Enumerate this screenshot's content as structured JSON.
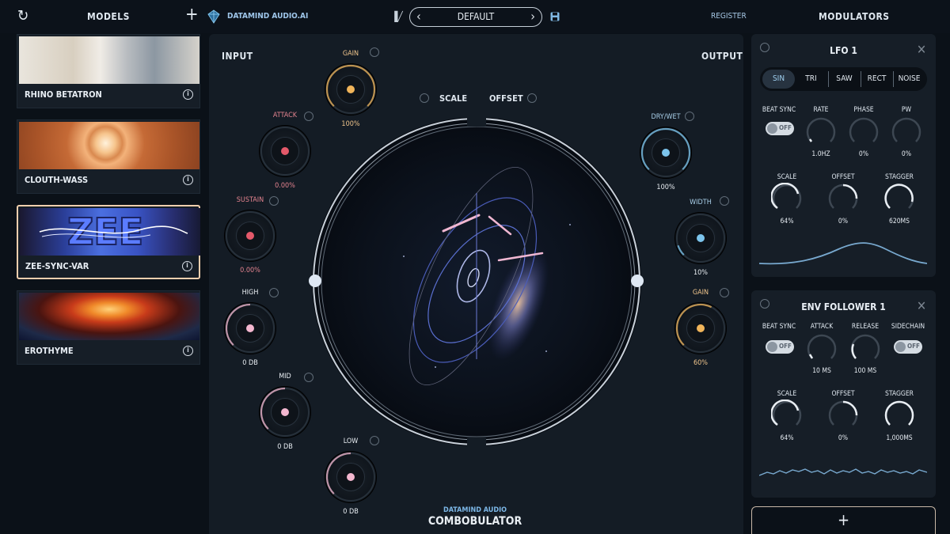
{
  "header": {
    "models_title": "MODELS",
    "brand_link": "DATAMIND AUDIO.AI",
    "preset_name": "DEFAULT",
    "register_label": "REGISTER",
    "modulators_title": "MODULATORS"
  },
  "models": [
    {
      "name": "RHINO BETATRON",
      "selected": false
    },
    {
      "name": "CLOUTH-WASS",
      "selected": false
    },
    {
      "name": "ZEE-SYNC-VAR",
      "selected": true
    },
    {
      "name": "EROTHYME",
      "selected": false
    }
  ],
  "main": {
    "input_label": "INPUT",
    "output_label": "OUTPUT",
    "scale_label": "SCALE",
    "offset_label": "OFFSET",
    "footer_brand": "DATAMIND AUDIO",
    "footer_product": "COMBOBULATOR",
    "knobs": {
      "gain_in": {
        "title": "GAIN",
        "value": "100%",
        "color": "#f0b45a",
        "level": 1.0
      },
      "attack": {
        "title": "ATTACK",
        "value": "0.00%",
        "color": "#e4596a",
        "level": 0.0
      },
      "sustain": {
        "title": "SUSTAIN",
        "value": "0.00%",
        "color": "#e4596a",
        "level": 0.0
      },
      "high": {
        "title": "HIGH",
        "value": "0 DB",
        "color": "#f3b7cf",
        "level": 0.5
      },
      "mid": {
        "title": "MID",
        "value": "0 DB",
        "color": "#f3b7cf",
        "level": 0.5
      },
      "low": {
        "title": "LOW",
        "value": "0 DB",
        "color": "#f3b7cf",
        "level": 0.5
      },
      "dry_wet": {
        "title": "DRY/WET",
        "value": "100%",
        "color": "#7cc4ec",
        "level": 1.0
      },
      "width": {
        "title": "WIDTH",
        "value": "10%",
        "color": "#7cc4ec",
        "level": 0.1
      },
      "gain_out": {
        "title": "GAIN",
        "value": "60%",
        "color": "#f0b45a",
        "level": 0.6
      }
    }
  },
  "lfo": {
    "title": "LFO 1",
    "waves": [
      "SIN",
      "TRI",
      "SAW",
      "RECT",
      "NOISE"
    ],
    "active_wave": "SIN",
    "beat_sync_label": "BEAT SYNC",
    "beat_sync_state": "OFF",
    "rate_label": "RATE",
    "rate_value": "1.0HZ",
    "phase_label": "PHASE",
    "phase_value": "0%",
    "pw_label": "PW",
    "pw_value": "0%",
    "scale_label": "SCALE",
    "scale_value": "64%",
    "offset_label": "OFFSET",
    "offset_value": "0%",
    "stagger_label": "STAGGER",
    "stagger_value": "620MS"
  },
  "env": {
    "title": "ENV FOLLOWER 1",
    "beat_sync_label": "BEAT SYNC",
    "beat_sync_state": "OFF",
    "attack_label": "ATTACK",
    "attack_value": "10 MS",
    "release_label": "RELEASE",
    "release_value": "100 MS",
    "sidechain_label": "SIDECHAIN",
    "sidechain_state": "OFF",
    "scale_label": "SCALE",
    "scale_value": "64%",
    "offset_label": "OFFSET",
    "offset_value": "0%",
    "stagger_label": "STAGGER",
    "stagger_value": "1,000MS"
  },
  "icons": {
    "refresh": "refresh-icon",
    "add": "plus-icon",
    "library": "library-icon",
    "save": "save-icon",
    "info": "info-icon",
    "close": "close-icon"
  }
}
